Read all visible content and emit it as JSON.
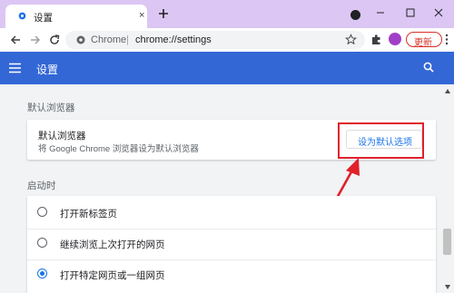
{
  "tab": {
    "title": "设置",
    "close": "×"
  },
  "omnibox": {
    "host": "Chrome",
    "separator": "|",
    "path": "chrome://settings"
  },
  "update_button": {
    "label": "更新"
  },
  "app": {
    "title": "设置"
  },
  "default_browser": {
    "section_title": "默认浏览器",
    "name": "默认浏览器",
    "description": "将 Google Chrome 浏览器设为默认浏览器",
    "button_label": "设为默认选项"
  },
  "startup": {
    "section_title": "启动时",
    "options": [
      {
        "label": "打开新标签页",
        "checked": false
      },
      {
        "label": "继续浏览上次打开的网页",
        "checked": false
      },
      {
        "label": "打开特定网页或一组网页",
        "checked": true
      }
    ]
  },
  "colors": {
    "title_bar": "#dcc6f4",
    "app_bar": "#3367d6",
    "accent": "#1a73e8",
    "annotation": "#e0202a",
    "update": "#d93025"
  },
  "icons": [
    "gear-icon",
    "plus-icon",
    "media-icon",
    "minimize-icon",
    "maximize-icon",
    "close-icon",
    "back-arrow-icon",
    "forward-arrow-icon",
    "reload-icon",
    "site-info-icon",
    "star-icon",
    "puzzle-extension-icon",
    "profile-icon",
    "more-vert-icon",
    "hamburger-menu-icon",
    "search-icon"
  ]
}
